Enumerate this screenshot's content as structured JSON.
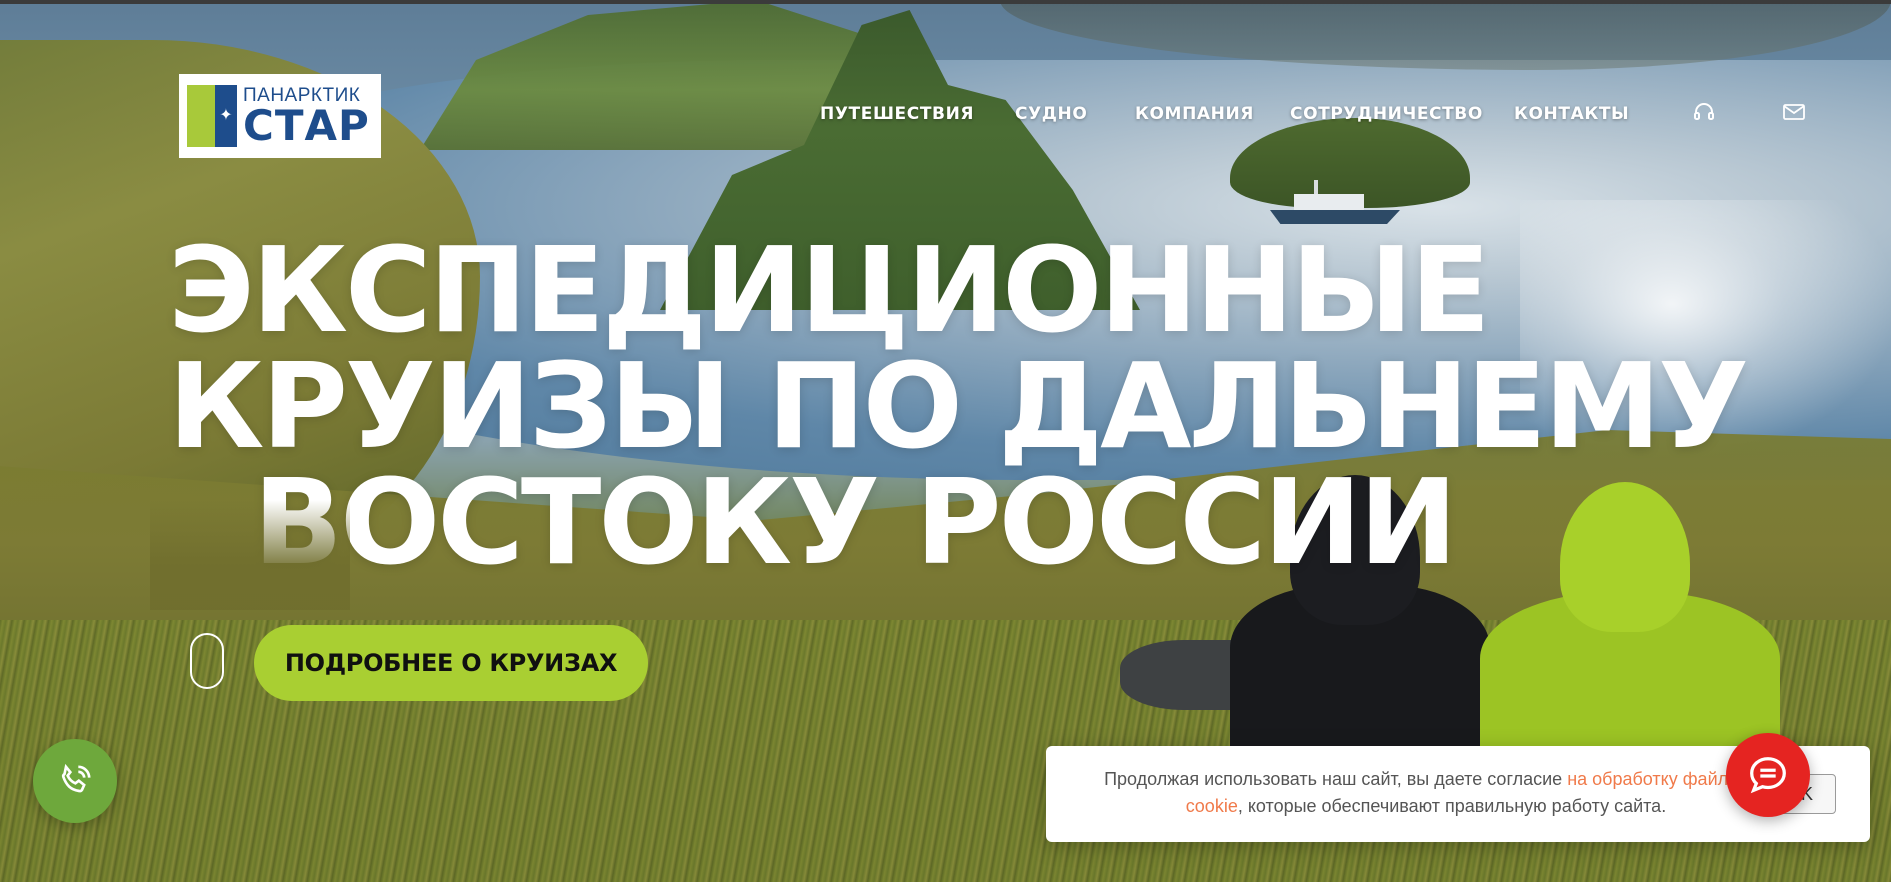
{
  "brand": {
    "line1": "ПАНАРКТИК",
    "line2": "СТАР",
    "colors": {
      "green": "#a8c93a",
      "blue": "#1e4d8c"
    }
  },
  "nav": {
    "items": [
      {
        "label": "ПУТЕШЕСТВИЯ"
      },
      {
        "label": "СУДНО"
      },
      {
        "label": "КОМПАНИЯ"
      },
      {
        "label": "СОТРУДНИЧЕСТВО"
      },
      {
        "label": "КОНТАКТЫ"
      }
    ],
    "icons": [
      "headset-icon",
      "mail-icon"
    ]
  },
  "hero": {
    "headline": [
      "ЭКСПЕДИЦИОННЫЕ",
      "КРУИЗЫ ПО ДАЛЬНЕМУ",
      "ВОСТОКУ РОССИИ"
    ],
    "cta_label": "ПОДРОБНЕЕ О КРУИЗАХ",
    "accent_color": "#a9cf32"
  },
  "cookie": {
    "text_before": "Продолжая использовать наш сайт, вы даете согласие ",
    "link_text": "на обработку файлов cookie",
    "text_after": ", которые обеспечивают правильную работу сайта.",
    "button_label": "OK",
    "link_color": "#f07a4a"
  },
  "widgets": {
    "phone_color": "#6ea83c",
    "chat_color": "#e52421"
  }
}
